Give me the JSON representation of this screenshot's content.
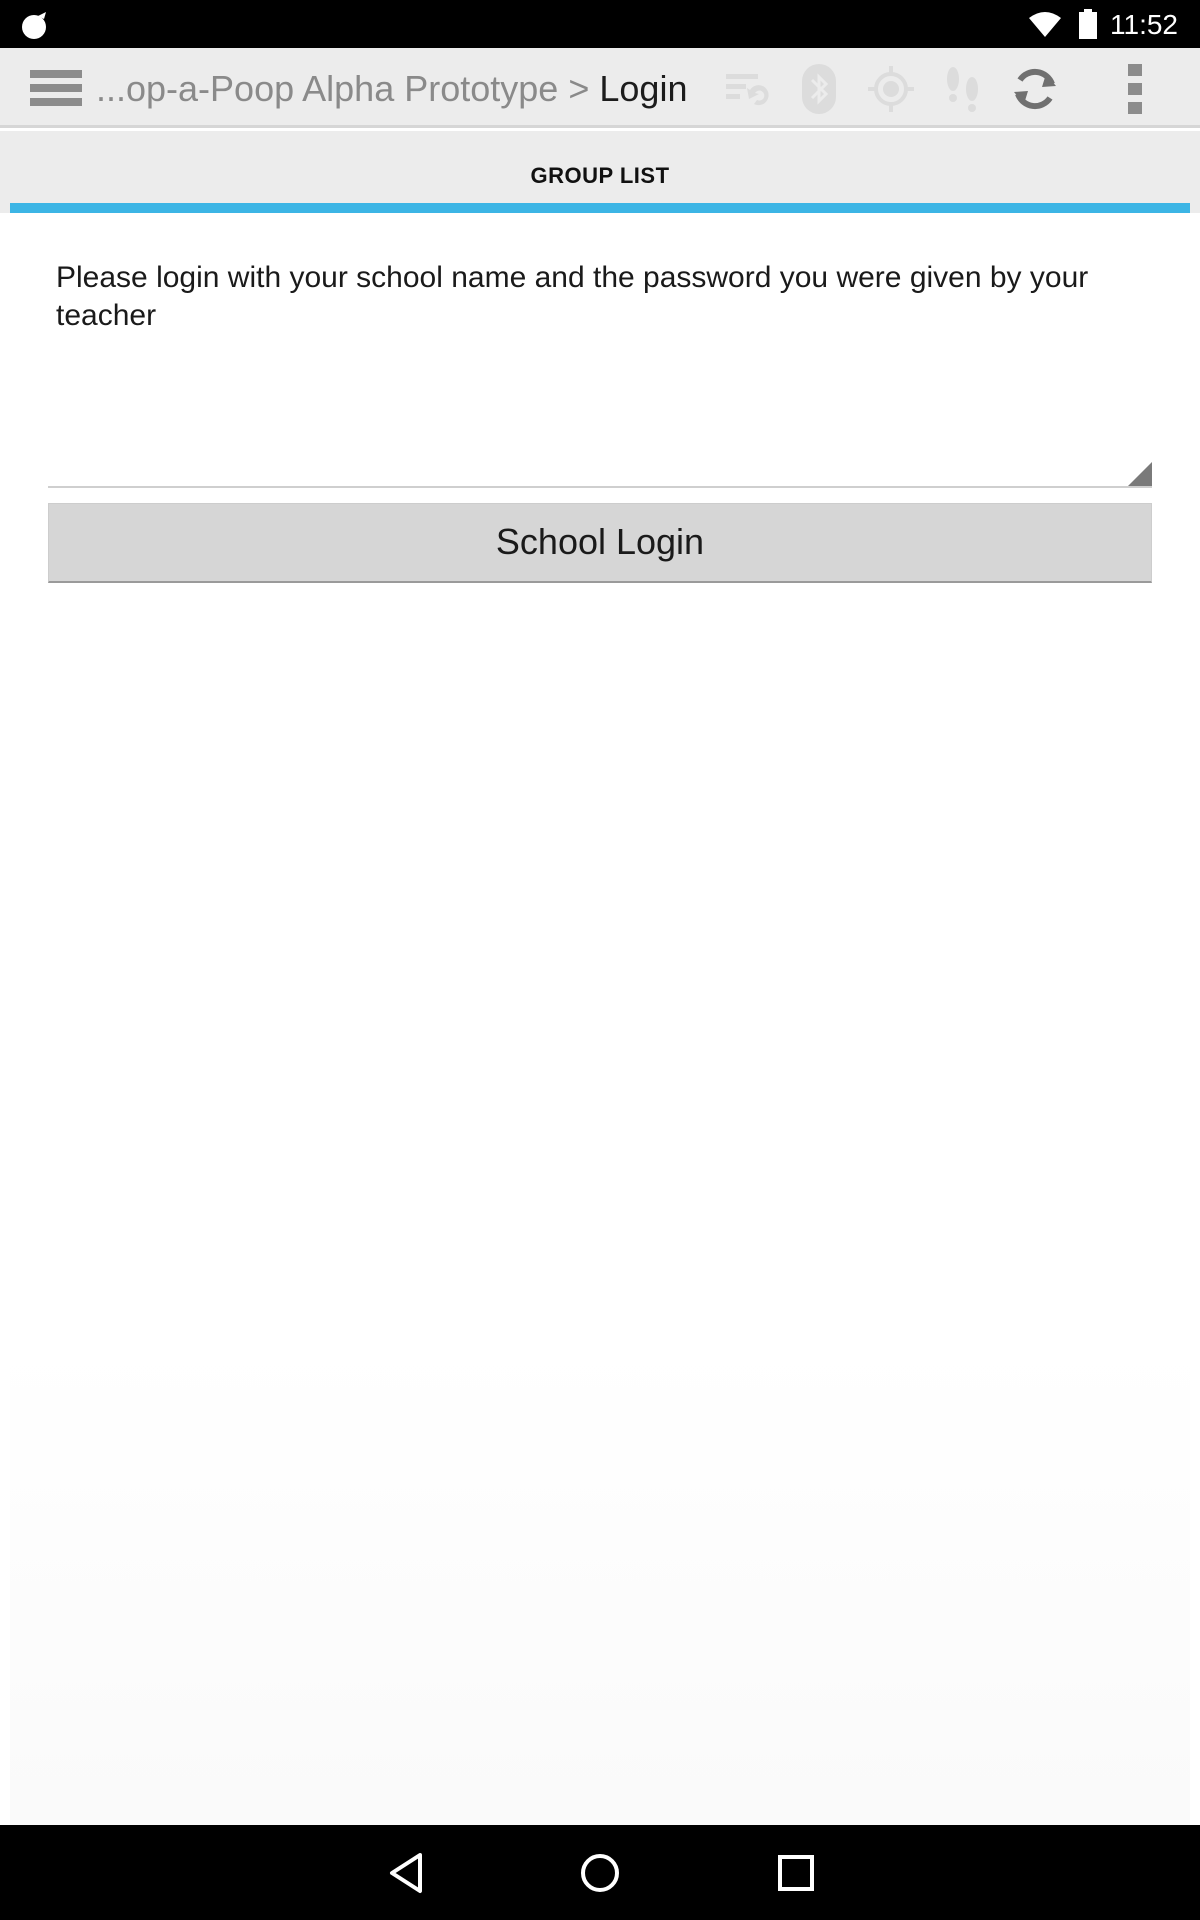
{
  "status_bar": {
    "time": "11:52",
    "icons": [
      "app-notification-icon",
      "wifi-icon",
      "battery-icon"
    ]
  },
  "action_bar": {
    "title_prefix": "...op-a-Poop Alpha Prototype",
    "separator": ">",
    "title_current": "Login",
    "icons": [
      "drawer-icon",
      "sync-status-icon",
      "bluetooth-icon",
      "location-icon",
      "steps-icon",
      "refresh-icon",
      "overflow-menu-icon"
    ]
  },
  "tabs": {
    "active_label": "GROUP LIST",
    "indicator_color": "#3cb5e5"
  },
  "login": {
    "instructions": "Please login with your school name and the password you were given by your teacher",
    "input_value": "",
    "button_label": "School Login"
  },
  "nav_bar": {
    "icons": [
      "back-icon",
      "home-icon",
      "recents-icon"
    ]
  }
}
